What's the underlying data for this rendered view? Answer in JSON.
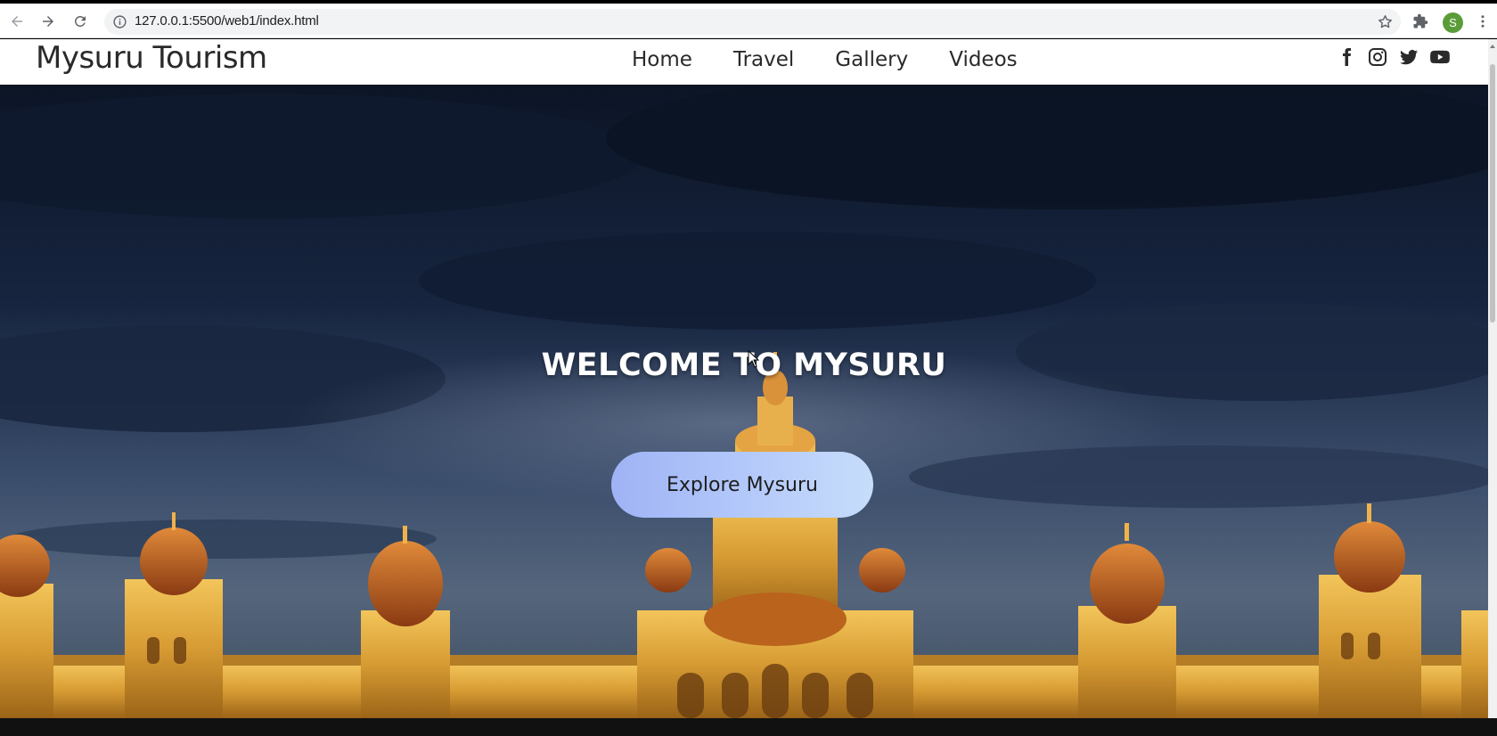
{
  "browser": {
    "url": "127.0.0.1:5500/web1/index.html",
    "profile_initial": "S",
    "profile_color": "#5b9c39"
  },
  "site": {
    "brand": "Mysuru Tourism",
    "nav": [
      {
        "label": "Home"
      },
      {
        "label": "Travel"
      },
      {
        "label": "Gallery"
      },
      {
        "label": "Videos"
      }
    ],
    "socials": [
      "facebook-icon",
      "instagram-icon",
      "twitter-icon",
      "youtube-icon"
    ]
  },
  "hero": {
    "title": "WELCOME TO MYSURU",
    "button_label": "Explore Mysuru",
    "button_gradient": [
      "#9fb3f5",
      "#c7ddfb"
    ]
  }
}
